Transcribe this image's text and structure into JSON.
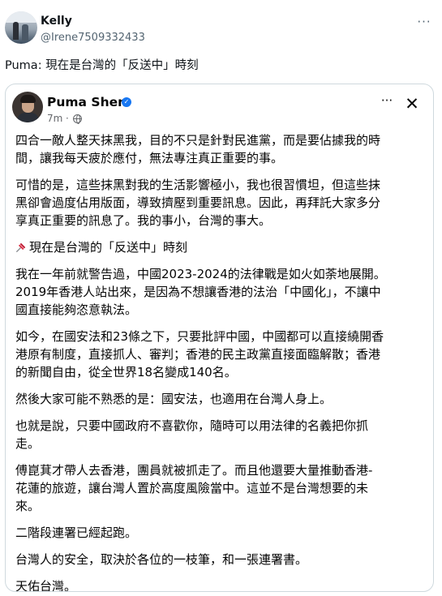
{
  "tweet": {
    "author_name": "Kelly",
    "author_handle": "@Irene7509332433",
    "more_label": "···",
    "text": "Puma: 現在是台灣的「反送中」時刻"
  },
  "embedded_post": {
    "author_name": "Puma Shen",
    "verified_mark": "✓",
    "time": "7m",
    "separator": "·",
    "more_label": "···",
    "close_label": "✕",
    "paragraphs": [
      [
        "四合一敵人整天抹黑我，目的不只是針對民進黨，而是要佔據我的時",
        "間，讓我每天疲於應付，無法專注真正重要的事。"
      ],
      [
        "可惜的是，這些抹黑對我的生活影響極小，我也很習慣坦，但這些抹",
        "黑卻會過度佔用版面，導致擠壓到重要訊息。因此，再拜託大家多分",
        "享真正重要的訊息了。我的事小，台灣的事大。"
      ],
      [
        "現在是台灣的「反送中」時刻"
      ],
      [
        "我在一年前就警告過，中國2023-2024的法律戰是如火如荼地展開。",
        "2019年香港人站出來，是因為不想讓香港的法治「中國化」，不讓中",
        "國直接能夠恣意執法。"
      ],
      [
        "如今，在國安法和23條之下，只要批評中國，中國都可以直接繞開香",
        "港原有制度，直接抓人、審判；香港的民主政黨直接面臨解散；香港",
        "的新聞自由，從全世界18名變成140名。"
      ],
      [
        "然後大家可能不熟悉的是：國安法，也適用在台灣人身上。"
      ],
      [
        "也就是說，只要中國政府不喜歡你，隨時可以用法律的名義把你抓",
        "走。"
      ],
      [
        "傅崑萁才帶人去香港，團員就被抓走了。而且他還要大量推動香港-",
        "花蓮的旅遊，讓台灣人置於高度風險當中。這並不是台灣想要的未",
        "來。"
      ],
      [
        "二階段連署已經起跑。"
      ],
      [
        "台灣人的安全，取決於各位的一枝筆，和一張連署書。"
      ],
      [
        "天佑台灣。"
      ]
    ],
    "pin_icon": "pushpin-icon"
  },
  "colors": {
    "facebook_blue": "#1877f2",
    "pin_red": "#dd2e44",
    "muted": "#65676b",
    "handle_gray": "#536471",
    "card_border": "#cfd9de"
  }
}
